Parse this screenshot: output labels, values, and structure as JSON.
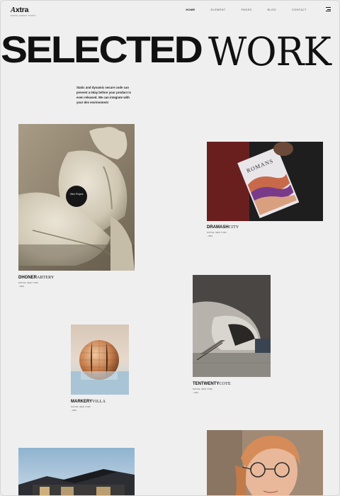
{
  "header": {
    "logo_letter": "A",
    "logo_rest": "xtra",
    "logo_tagline": "DIGITAL AGENCY STUDIO",
    "nav": [
      "HOME",
      "ELEMENT",
      "PAGES",
      "BLOG",
      "CONTACT"
    ],
    "active_nav": "HOME",
    "menu_icon": "hamburger-menu-icon"
  },
  "hero": {
    "title_bold": "SELECTED",
    "title_thin": "WORK",
    "description": "Static and dynamic secure code can prevent a 0day before your product is even released. We can integrate with your dev environment"
  },
  "projects": [
    {
      "bold": "DHONER",
      "thin": "ARTERY",
      "location": "NATIVE, NEW YORK",
      "year": "– 2019",
      "view_label": "View Project"
    },
    {
      "bold": "DRAMASH",
      "thin": "CITY",
      "location": "NATIVE, NEW YORK",
      "year": "– 2019",
      "book_text": "ROMANS"
    },
    {
      "bold": "TENTWENTY",
      "thin": "COTE",
      "location": "NATIVE, NEW YORK",
      "year": "– 2019"
    },
    {
      "bold": "MARKERY",
      "thin": "VILLA",
      "location": "NATIVE, NEW YORK",
      "year": "– 2019"
    }
  ],
  "colors": {
    "background": "#efeff0",
    "text": "#111111",
    "view_button": "#161616"
  }
}
